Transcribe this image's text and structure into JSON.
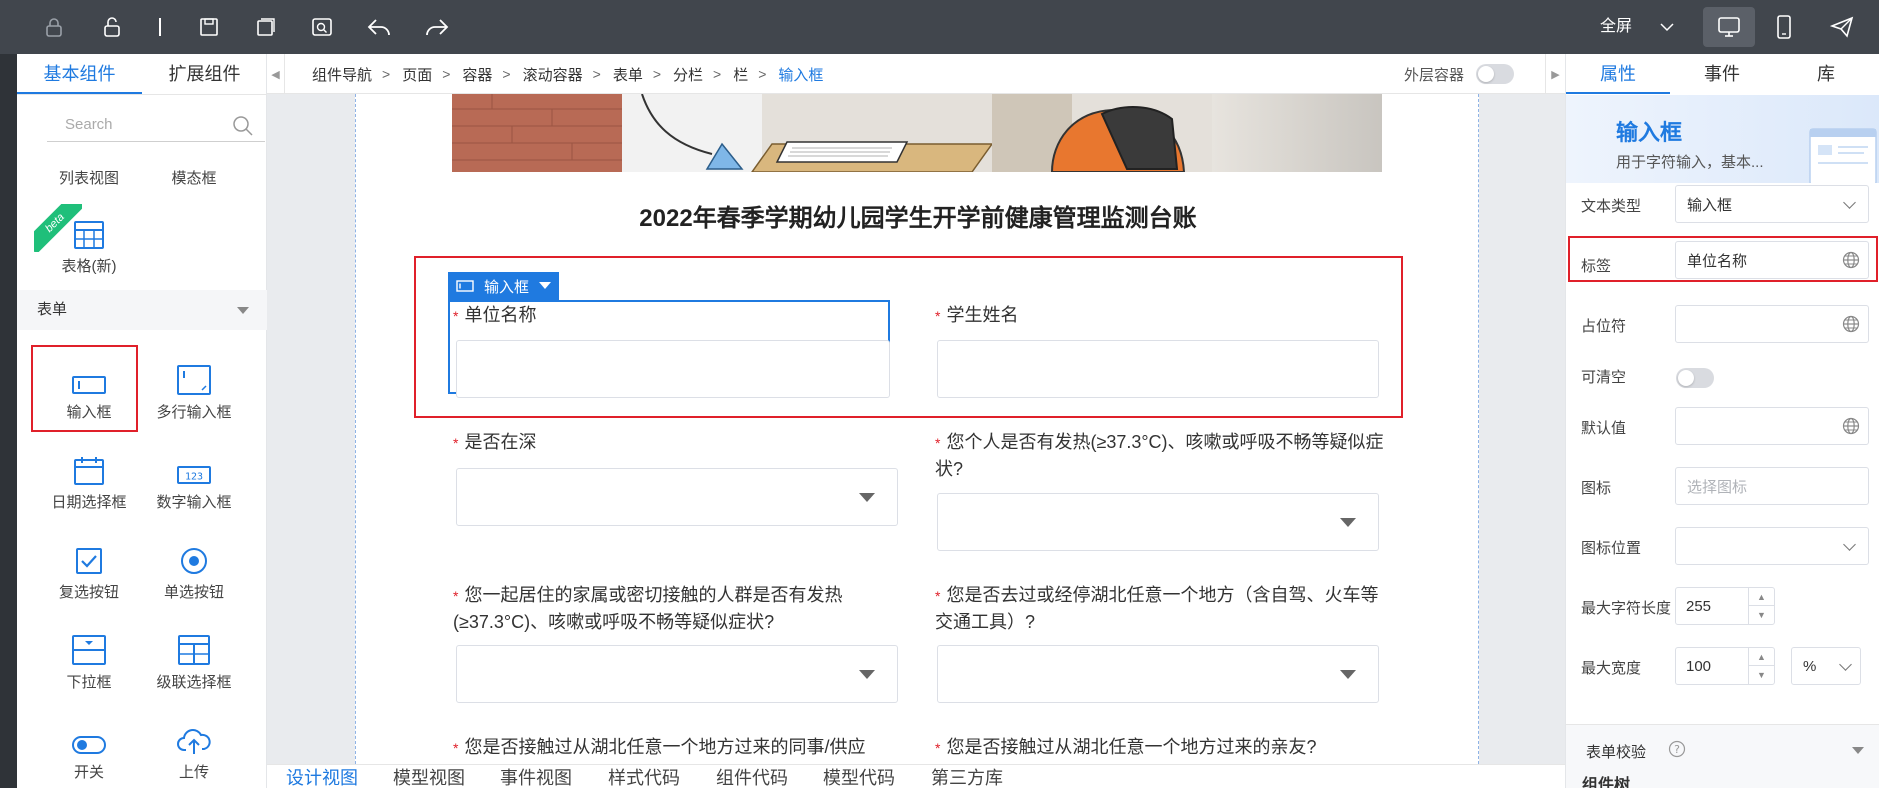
{
  "toolbar": {
    "fullscreen_label": "全屏"
  },
  "left_panel": {
    "tabs": [
      "基本组件",
      "扩展组件"
    ],
    "search_placeholder": "Search",
    "beta_badge": "beta",
    "top_items": [
      "列表视图",
      "模态框",
      "表格(新)"
    ],
    "section_title": "表单",
    "form_items": [
      "输入框",
      "多行输入框",
      "日期选择框",
      "数字输入框",
      "复选按钮",
      "单选按钮",
      "下拉框",
      "级联选择框",
      "开关",
      "上传"
    ]
  },
  "breadcrumb": {
    "items": [
      "组件导航",
      "页面",
      "容器",
      "滚动容器",
      "表单",
      "分栏",
      "栏",
      "输入框"
    ],
    "outer_container_label": "外层容器"
  },
  "canvas": {
    "form_title": "2022年春季学期幼儿园学生开学前健康管理监测台账",
    "component_tag": "输入框",
    "fields": [
      {
        "label": "单位名称"
      },
      {
        "label": "学生姓名"
      },
      {
        "label": "是否在深"
      },
      {
        "label": "您个人是否有发热(≥37.3°C)、咳嗽或呼吸不畅等疑似症状?"
      },
      {
        "label": "您一起居住的家属或密切接触的人群是否有发热(≥37.3°C)、咳嗽或呼吸不畅等疑似症状?"
      },
      {
        "label": "您是否去过或经停湖北任意一个地方（含自驾、火车等交通工具）?"
      },
      {
        "label": "您是否接触过从湖北任意一个地方过来的同事/供应"
      },
      {
        "label": "您是否接触过从湖北任意一个地方过来的亲友?"
      }
    ]
  },
  "bottom_tabs": [
    "设计视图",
    "模型视图",
    "事件视图",
    "样式代码",
    "组件代码",
    "模型代码",
    "第三方库"
  ],
  "right_panel": {
    "tabs": [
      "属性",
      "事件",
      "库"
    ],
    "component_title": "输入框",
    "component_desc": "用于字符输入，基本...",
    "props": {
      "text_type_label": "文本类型",
      "text_type_value": "输入框",
      "tag_label": "标签",
      "tag_value": "单位名称",
      "placeholder_label": "占位符",
      "clearable_label": "可清空",
      "default_label": "默认值",
      "icon_label": "图标",
      "icon_placeholder": "选择图标",
      "icon_pos_label": "图标位置",
      "maxlen_label": "最大字符长度",
      "maxlen_value": "255",
      "maxwidth_label": "最大宽度",
      "maxwidth_value": "100",
      "maxwidth_unit": "%"
    },
    "rules_label": "表单校验",
    "tree_label": "组件树"
  }
}
